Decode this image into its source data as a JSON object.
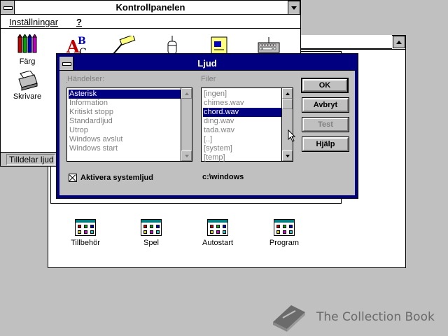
{
  "control_panel": {
    "title": "Kontrollpanelen",
    "menu": {
      "settings": "Inställningar",
      "help": "?"
    },
    "icons": [
      {
        "label": "Färg",
        "icon": "color-pencils-icon"
      },
      {
        "label": "Skrivare",
        "icon": "printer-icon"
      }
    ],
    "status": "Tilldelar ljud"
  },
  "program_manager": {
    "groups": [
      {
        "label": "Tillbehör"
      },
      {
        "label": "Spel"
      },
      {
        "label": "Autostart"
      },
      {
        "label": "Program"
      }
    ]
  },
  "sound_dialog": {
    "title": "Ljud",
    "events_label": "Händelser:",
    "events": [
      "Asterisk",
      "Information",
      "Kritiskt stopp",
      "Standardljud",
      "Utrop",
      "Windows avslut",
      "Windows start"
    ],
    "selected_event": "Asterisk",
    "files_label": "Filer",
    "files": [
      "[ingen]",
      "chimes.wav",
      "chord.wav",
      "ding.wav",
      "tada.wav",
      "[..]",
      "[system]",
      "[temp]"
    ],
    "selected_file": "chord.wav",
    "checkbox_label": "Aktivera systemljud",
    "checkbox_checked": true,
    "current_dir": "c:\\windows",
    "buttons": {
      "ok": "OK",
      "cancel": "Avbryt",
      "test": "Test",
      "help": "Hjälp"
    }
  },
  "watermark": {
    "text": "The Collection Book"
  },
  "colors": {
    "title_active": "#000080",
    "face": "#c0c0c0",
    "text_disabled": "#808080"
  }
}
